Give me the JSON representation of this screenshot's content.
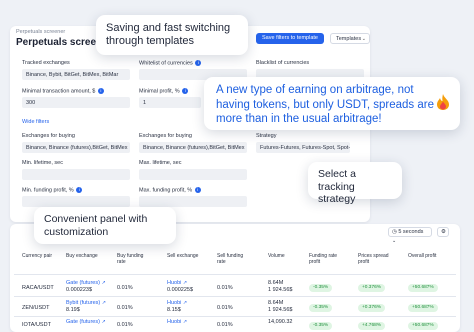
{
  "screener": {
    "breadcrumb": "Perpetuals screener",
    "title": "Perpetuals screener",
    "save_filters_button": "Save filters to template",
    "templates_button": "Templates",
    "fields": [
      {
        "id": "tracked_exchanges",
        "label": "Tracked exchanges",
        "value": "Binance, Bybit, BitGet, BitMex, BitMar"
      },
      {
        "id": "whitelist",
        "label": "Whitelist of currencies",
        "value": ""
      },
      {
        "id": "blacklist",
        "label": "Blacklist of currencies",
        "value": ""
      },
      {
        "id": "min_amount",
        "label": "Minimal transaction amount, $",
        "value": "300"
      },
      {
        "id": "min_profit",
        "label": "Minimal profit, %",
        "value": "1"
      },
      {
        "id": "exchanges_buying",
        "label": "Exchanges for buying",
        "value": "Binance, Binance (futures),BitGet, BitMex"
      },
      {
        "id": "exchanges_selling",
        "label": "Exchanges for buying",
        "value": "Binance, Binance (futures),BitGet, BitMex"
      },
      {
        "id": "strategy",
        "label": "Strategy",
        "value": "Futures-Futures, Futures-Spot, Spot-..."
      },
      {
        "id": "min_lifetime",
        "label": "Min. lifetime, sec",
        "value": ""
      },
      {
        "id": "max_lifetime",
        "label": "Max. lifetime, sec",
        "value": ""
      },
      {
        "id": "min_funding",
        "label": "Min. funding profit, %",
        "value": ""
      },
      {
        "id": "max_funding",
        "label": "Max. funding profit, %",
        "value": ""
      }
    ],
    "wide_filters": "Wide filters"
  },
  "callouts": {
    "templates": "Saving and fast switching through templates",
    "earning": "A new type of earning on arbitrage, not having tokens, but only USDT, spreads are more than in the usual arbitrage!",
    "strategy": "Select a tracking strategy",
    "panel": "Convenient panel with customization"
  },
  "table": {
    "refresh_select": "5 seconds",
    "headers": [
      "Currency pair",
      "Buy exchange",
      "Buy funding rate",
      "Sell exchange",
      "Sell funding rate",
      "Volume",
      "Funding rate profit",
      "Prices spread profit",
      "Overall profit"
    ],
    "rows": [
      {
        "pair": "RACA/USDT",
        "buy_exchange": "Gate (futures)",
        "buy_price": "0.000223$",
        "buy_rate": "0.01%",
        "sell_exchange": "Huobi",
        "sell_price": "0.000225$",
        "sell_rate": "0.01%",
        "volume": "8.64M",
        "volume_usd": "1 924.56$",
        "funding_profit": "-0.35%",
        "spread_profit": "+0.376%",
        "overall_profit": "+50.687%"
      },
      {
        "pair": "ZEN/USDT",
        "buy_exchange": "Bybit (futures)",
        "buy_price": "8.19$",
        "buy_rate": "0.01%",
        "sell_exchange": "Huobi",
        "sell_price": "8.15$",
        "sell_rate": "0.01%",
        "volume": "8.64M",
        "volume_usd": "1 924.56$",
        "funding_profit": "-0.35%",
        "spread_profit": "+0.376%",
        "overall_profit": "+50.687%"
      },
      {
        "pair": "IOTA/USDT",
        "buy_exchange": "Gate (futures)",
        "buy_price": "",
        "buy_rate": "0.01%",
        "sell_exchange": "Huobi",
        "sell_price": "",
        "sell_rate": "0.01%",
        "volume": "14,090.32",
        "volume_usd": "",
        "funding_profit": "-0.35%",
        "spread_profit": "+4.768%",
        "overall_profit": "+50.687%"
      }
    ]
  },
  "colors": {
    "accent": "#2563eb",
    "positive_bg": "#dff5e3",
    "positive_text": "#23913f",
    "callout_highlight": "#1d5fe0"
  },
  "icons": [
    "info-icon",
    "chevron-down-icon",
    "flame-icon",
    "external-link-icon",
    "settings-icon"
  ]
}
